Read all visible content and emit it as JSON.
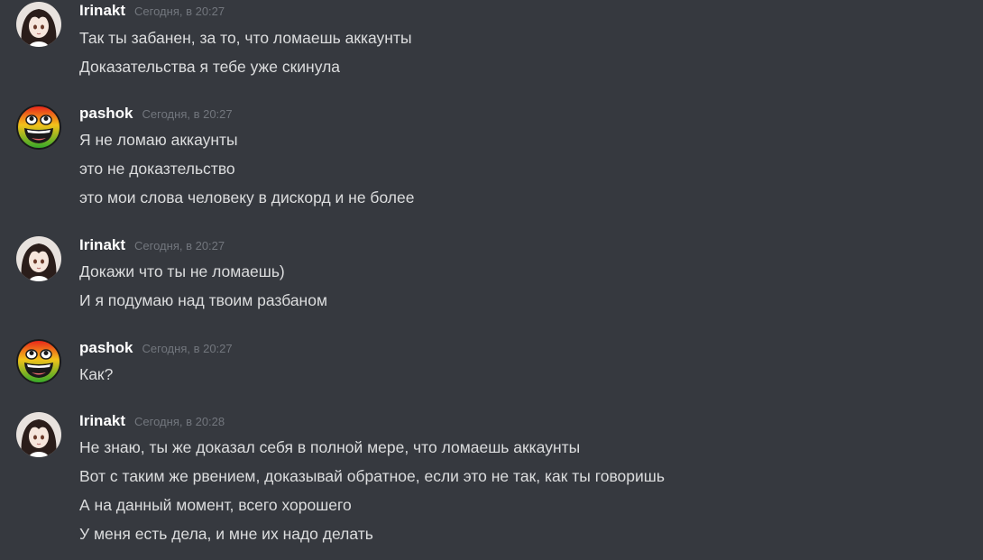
{
  "groups": [
    {
      "author": "Irinakt",
      "avatar_icon": "anime-girl-avatar-icon",
      "timestamp": "Сегодня, в 20:27",
      "messages": [
        "Так ты забанен, за то, что ломаешь аккаунты",
        "Доказательства я тебе уже скинула"
      ]
    },
    {
      "author": "pashok",
      "avatar_icon": "awesome-face-avatar-icon",
      "timestamp": "Сегодня, в 20:27",
      "messages": [
        "Я не ломаю аккаунты",
        "это не доказтельство",
        "это мои слова человеку в дискорд и не более"
      ]
    },
    {
      "author": "Irinakt",
      "avatar_icon": "anime-girl-avatar-icon",
      "timestamp": "Сегодня, в 20:27",
      "messages": [
        "Докажи что ты не ломаешь)",
        "И я подумаю над твоим разбаном"
      ]
    },
    {
      "author": "pashok",
      "avatar_icon": "awesome-face-avatar-icon",
      "timestamp": "Сегодня, в 20:27",
      "messages": [
        "Как?"
      ]
    },
    {
      "author": "Irinakt",
      "avatar_icon": "anime-girl-avatar-icon",
      "timestamp": "Сегодня, в 20:28",
      "messages": [
        "Не знаю, ты же доказал себя в полной мере, что ломаешь аккаунты",
        "Вот с таким же рвением, доказывай обратное, если это не так, как ты говоришь",
        "А на данный момент, всего хорошего",
        "У меня есть дела, и мне их надо делать"
      ]
    }
  ],
  "colors": {
    "background": "#36393f",
    "username": "#ffffff",
    "timestamp": "#72767d",
    "message_text": "#dcddde"
  }
}
